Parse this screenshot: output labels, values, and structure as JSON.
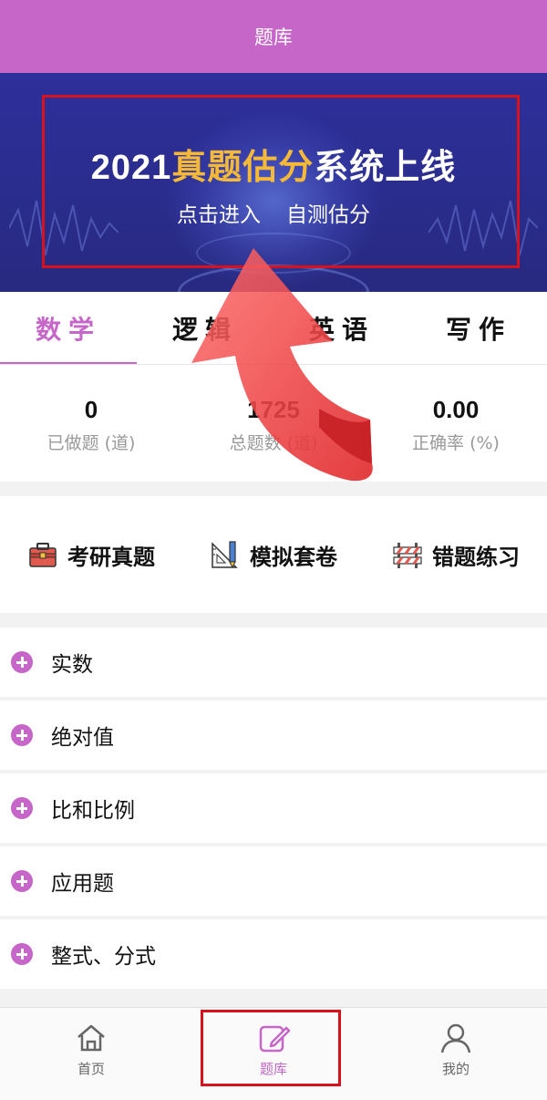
{
  "header": {
    "title": "题库"
  },
  "banner": {
    "year": "2021",
    "highlight": "真题估分",
    "suffix": "系统上线",
    "sub_left": "点击进入",
    "sub_right": "自测估分"
  },
  "subject_tabs": [
    {
      "label": "数学",
      "active": true
    },
    {
      "label": "逻辑",
      "active": false
    },
    {
      "label": "英语",
      "active": false
    },
    {
      "label": "写作",
      "active": false
    }
  ],
  "stats": [
    {
      "value": "0",
      "label": "已做题 (道)"
    },
    {
      "value": "1725",
      "label": "总题数 (道)"
    },
    {
      "value": "0.00",
      "label": "正确率 (%)"
    }
  ],
  "shortcuts": [
    {
      "label": "考研真题",
      "icon": "toolbox-icon"
    },
    {
      "label": "模拟套卷",
      "icon": "ruler-pencil-icon"
    },
    {
      "label": "错题练习",
      "icon": "barrier-icon"
    }
  ],
  "topics": [
    "实数",
    "绝对值",
    "比和比例",
    "应用题",
    "整式、分式"
  ],
  "tabbar": [
    {
      "label": "首页",
      "icon": "home-icon",
      "active": false
    },
    {
      "label": "题库",
      "icon": "edit-icon",
      "active": true
    },
    {
      "label": "我的",
      "icon": "user-icon",
      "active": false
    }
  ],
  "colors": {
    "accent": "#c766c9",
    "highlight": "#f5b93a",
    "banner_bg": "#2a2c8c",
    "annotation_red": "#d8121c"
  }
}
